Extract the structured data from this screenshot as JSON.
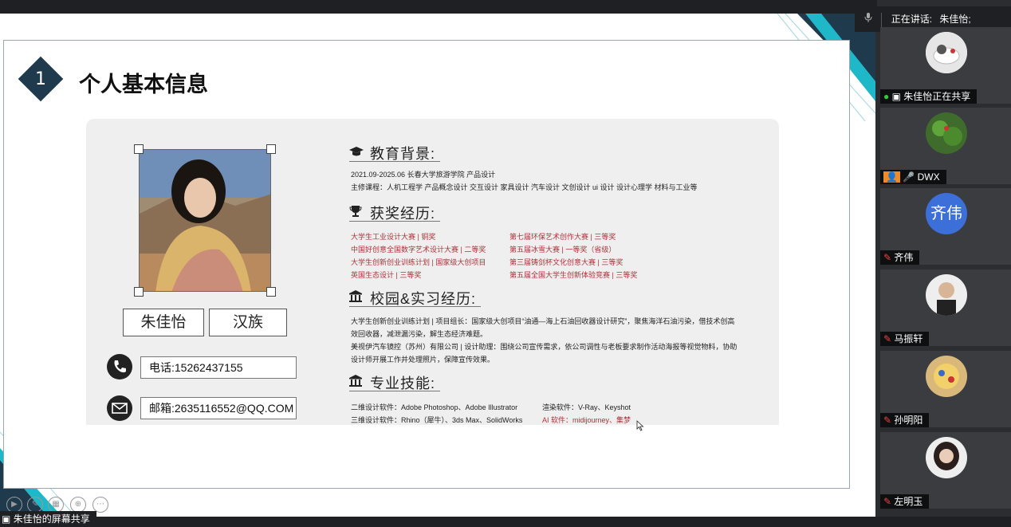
{
  "slide": {
    "section_number": "1",
    "title": "个人基本信息",
    "name": "朱佳怡",
    "ethnicity": "汉族",
    "phone": "电话:15262437155",
    "email": "邮箱:2635116552@QQ.COM",
    "education": {
      "heading": "教育背景:",
      "line1": "2021.09-2025.06    长春大学旅游学院    产品设计",
      "line2": "主修课程：人机工程学  产品概念设计  交互设计  家具设计  汽车设计  文创设计  ui 设计  设计心理学  材料与工业等"
    },
    "awards": {
      "heading": "获奖经历:",
      "left": [
        "大学生工业设计大赛 | 铜奖",
        "中国好创意全国数字艺术设计大赛 | 二等奖",
        "大学生创新创业训练计划 | 国家级大创项目",
        "英国生态设计 | 三等奖"
      ],
      "right": [
        "第七届环保艺术创作大赛 | 三等奖",
        "第五届冰雪大赛 | 一等奖（省级）",
        "第三届铸剑杯文化创意大赛 | 三等奖",
        "第五届全国大学生创新体验竞赛 | 三等奖"
      ]
    },
    "campus": {
      "heading": "校园&实习经历:",
      "lines": [
        "大学生创新创业训练计划 | 项目组长：国家级大创项目“油通—海上石油回收器设计研究”，聚焦海洋石油污染，借技术创高",
        "效回收器，减泄漏污染，解生态经济难题。",
        "美视伊汽车镜控（苏州）有限公司 | 设计助理：围绕公司宣传需求，依公司调性与老板要求制作活动海报等视觉物料，协助",
        "设计师开展工作并处理照片，保障宣传效果。"
      ]
    },
    "skills": {
      "heading": "专业技能:",
      "row1_left": "二维设计软件：Adobe Photoshop、Adobe Illustrator",
      "row1_right": "渲染软件：V-Ray、Keyshot",
      "row2_left": "三维设计软件：Rhino（犀牛）、3ds Max、SolidWorks",
      "row2_right": "AI 软件：midijourney、集梦"
    }
  },
  "meeting": {
    "speaking_label": "正在讲话:",
    "speaking_name": "朱佳怡;",
    "screen_share_label": "朱佳怡的屏幕共享",
    "participants": [
      {
        "label": "朱佳怡正在共享"
      },
      {
        "label": "DWX"
      },
      {
        "label": "齐伟",
        "avatar_text": "齐伟"
      },
      {
        "label": "马振轩"
      },
      {
        "label": "孙明阳"
      },
      {
        "label": "左明玉"
      }
    ]
  },
  "colors": {
    "accent_navy": "#1e3a4c",
    "accent_cyan": "#1fb8c8",
    "award_red": "#b0323a",
    "avatar_blue": "#3d6fd9"
  }
}
